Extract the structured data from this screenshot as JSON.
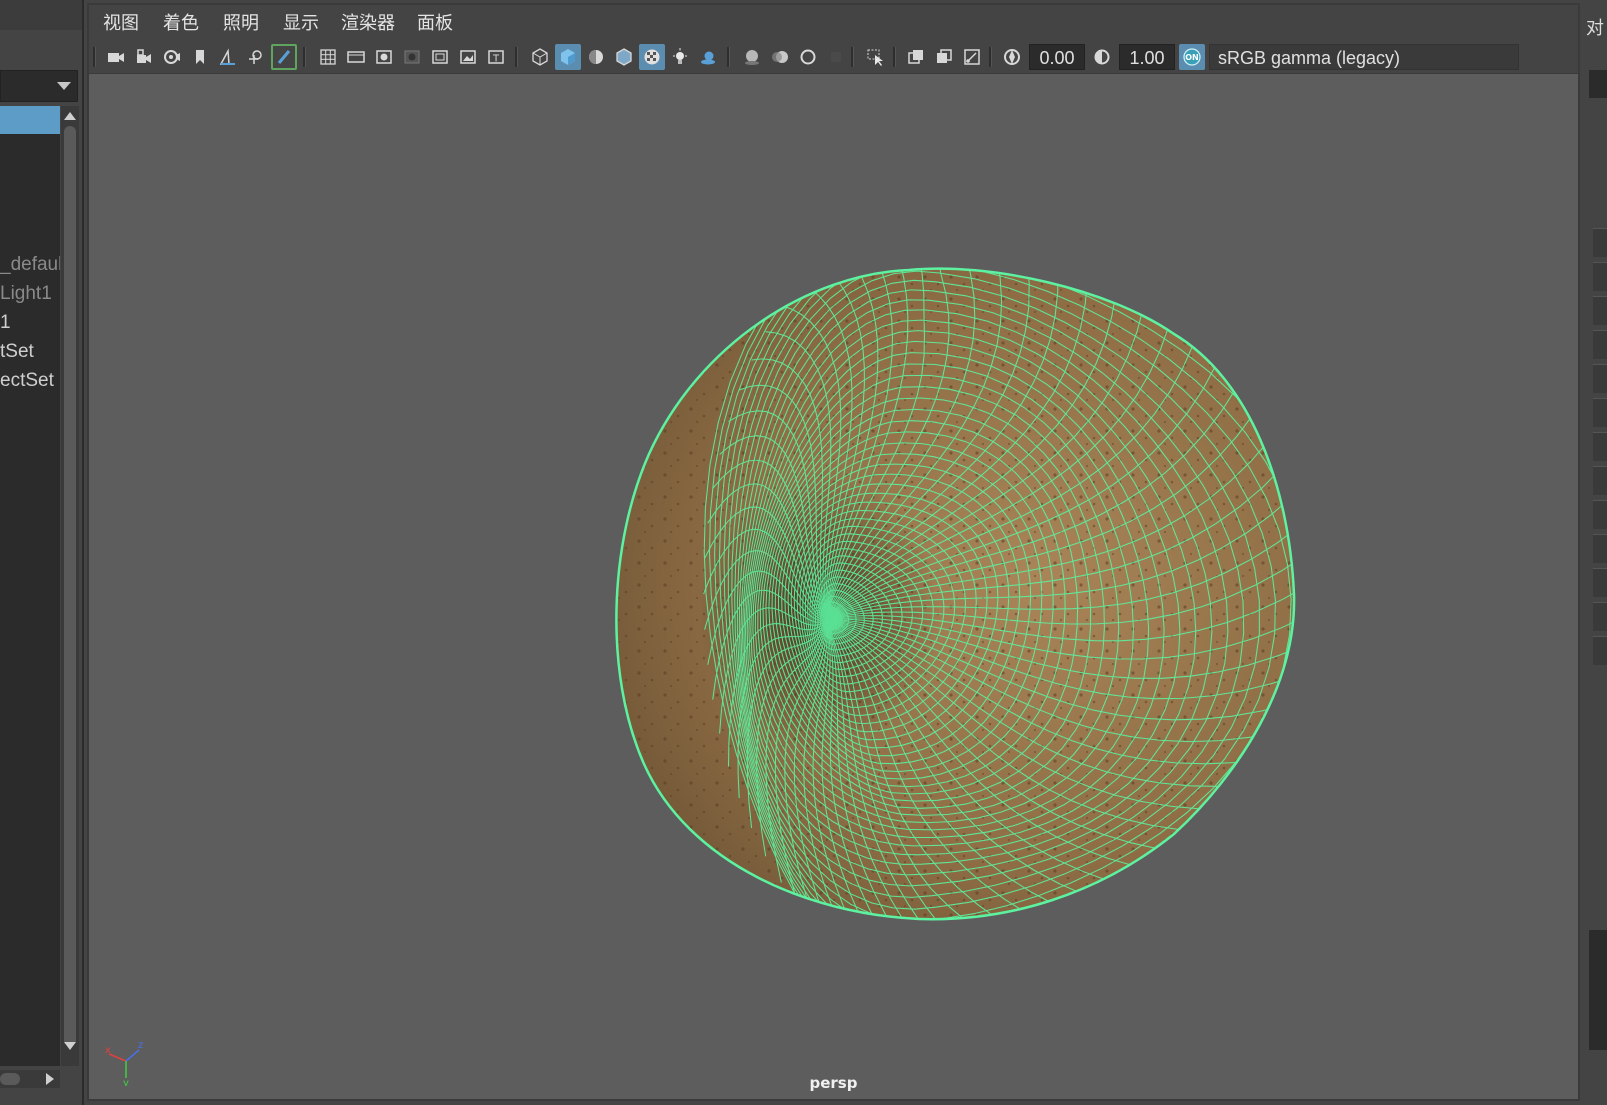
{
  "menubar": {
    "items": [
      "视图",
      "着色",
      "照明",
      "显示",
      "渲染器",
      "面板"
    ]
  },
  "toolbar": {
    "exposure_value": "0.00",
    "gamma_value": "1.00",
    "color_management_toggle": "ON",
    "color_space": "sRGB gamma (legacy)"
  },
  "outliner": {
    "items": [
      {
        "label": "_defaul",
        "muted": true
      },
      {
        "label": "Light1",
        "muted": true
      },
      {
        "label": "1",
        "muted": false
      },
      {
        "label": "tSet",
        "muted": false
      },
      {
        "label": "ectSet",
        "muted": false
      }
    ]
  },
  "viewport": {
    "camera_label": "persp",
    "axis_x": "x",
    "axis_y": "y",
    "axis_z": "z",
    "wireframe_color": "#5cf2a0",
    "surface_color": "#9a7a4e"
  },
  "right_panel": {
    "header_char": "对"
  }
}
